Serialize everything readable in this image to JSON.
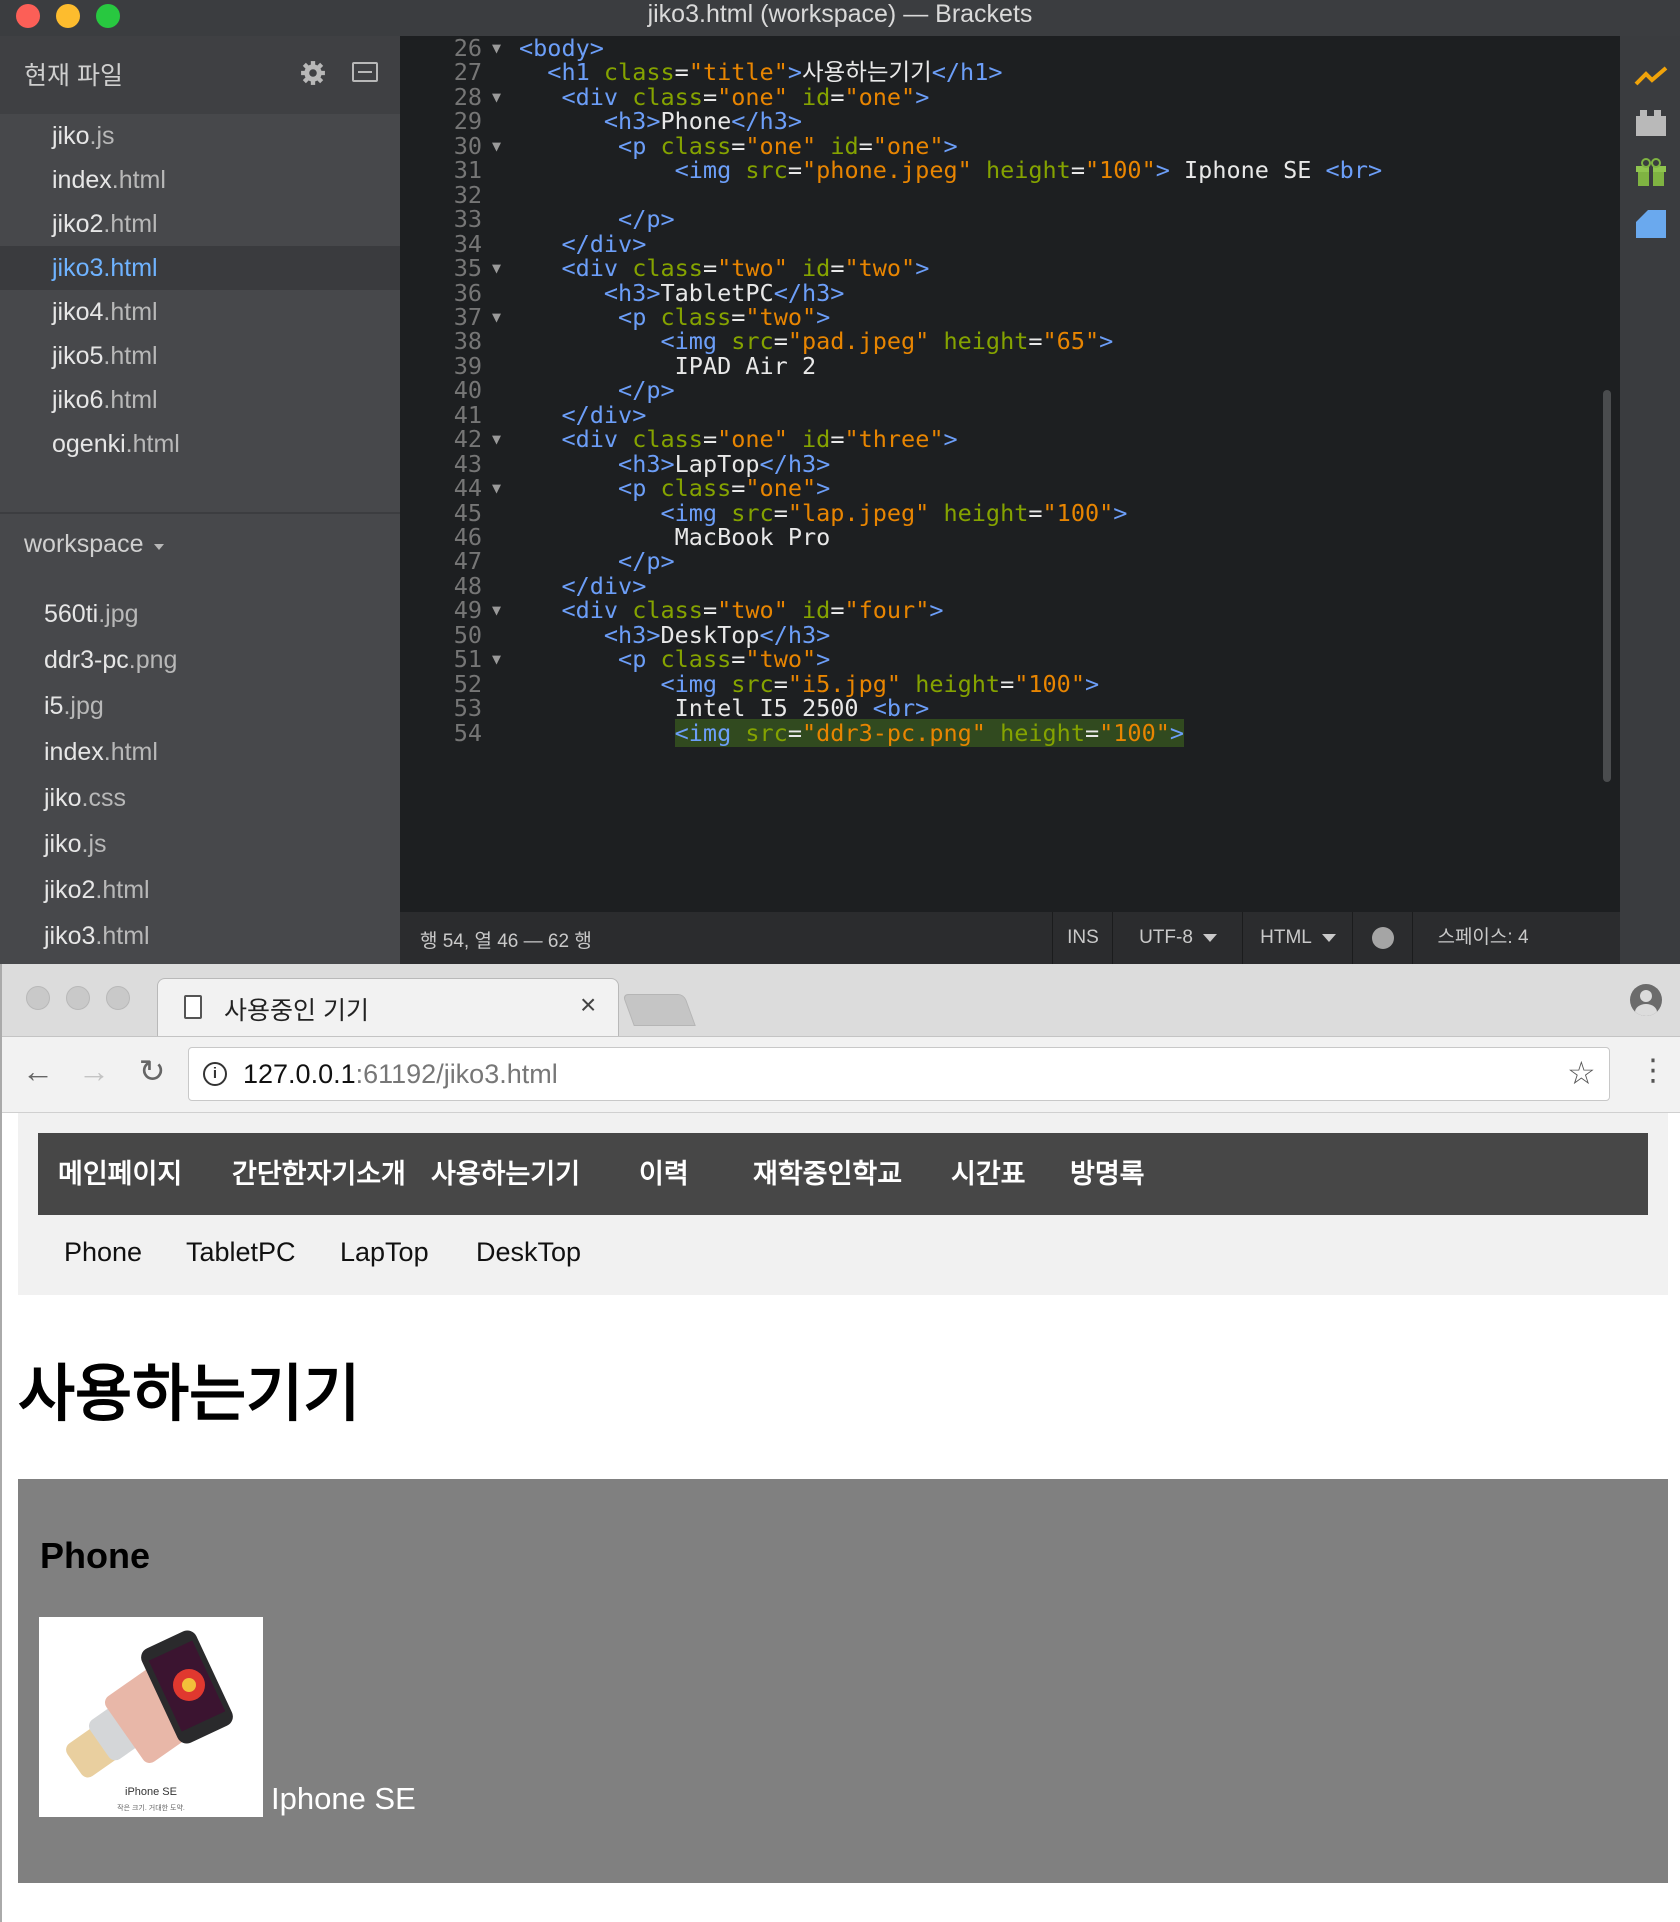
{
  "brackets": {
    "window_title": "jiko3.html (workspace) — Brackets",
    "working_files_title": "현재 파일",
    "working_files": [
      {
        "name": "jiko",
        "ext": ".js",
        "selected": false
      },
      {
        "name": "index",
        "ext": ".html",
        "selected": false
      },
      {
        "name": "jiko2",
        "ext": ".html",
        "selected": false
      },
      {
        "name": "jiko3",
        "ext": ".html",
        "selected": true
      },
      {
        "name": "jiko4",
        "ext": ".html",
        "selected": false
      },
      {
        "name": "jiko5",
        "ext": ".html",
        "selected": false
      },
      {
        "name": "jiko6",
        "ext": ".html",
        "selected": false
      },
      {
        "name": "ogenki",
        "ext": ".html",
        "selected": false
      }
    ],
    "project_title": "workspace",
    "project_files": [
      {
        "name": "560ti",
        "ext": ".jpg"
      },
      {
        "name": "ddr3-pc",
        "ext": ".png"
      },
      {
        "name": "i5",
        "ext": ".jpg"
      },
      {
        "name": "index",
        "ext": ".html"
      },
      {
        "name": "jiko",
        "ext": ".css"
      },
      {
        "name": "jiko",
        "ext": ".js"
      },
      {
        "name": "jiko2",
        "ext": ".html"
      },
      {
        "name": "jiko3",
        "ext": ".html"
      }
    ],
    "code_lines": [
      {
        "n": "26",
        "fold": true,
        "indent": "",
        "text": "<body>"
      },
      {
        "n": "27",
        "fold": false,
        "indent": "  ",
        "text": "<h1 class=\"title\">사용하는기기</h1>"
      },
      {
        "n": "28",
        "fold": true,
        "indent": "   ",
        "text": "<div class=\"one\" id=\"one\">"
      },
      {
        "n": "29",
        "fold": false,
        "indent": "      ",
        "text": "<h3>Phone</h3>"
      },
      {
        "n": "30",
        "fold": true,
        "indent": "       ",
        "text": "<p class=\"one\" id=\"one\">"
      },
      {
        "n": "31",
        "fold": false,
        "indent": "           ",
        "text": "<img src=\"phone.jpeg\" height=\"100\"> Iphone SE <br>"
      },
      {
        "n": "32",
        "fold": false,
        "indent": "",
        "text": ""
      },
      {
        "n": "33",
        "fold": false,
        "indent": "       ",
        "text": "</p>"
      },
      {
        "n": "34",
        "fold": false,
        "indent": "   ",
        "text": "</div>"
      },
      {
        "n": "35",
        "fold": true,
        "indent": "   ",
        "text": "<div class=\"two\" id=\"two\">"
      },
      {
        "n": "36",
        "fold": false,
        "indent": "      ",
        "text": "<h3>TabletPC</h3>"
      },
      {
        "n": "37",
        "fold": true,
        "indent": "       ",
        "text": "<p class=\"two\">"
      },
      {
        "n": "38",
        "fold": false,
        "indent": "          ",
        "text": "<img src=\"pad.jpeg\" height=\"65\">"
      },
      {
        "n": "39",
        "fold": false,
        "indent": "           ",
        "text": "IPAD Air 2"
      },
      {
        "n": "40",
        "fold": false,
        "indent": "       ",
        "text": "</p>"
      },
      {
        "n": "41",
        "fold": false,
        "indent": "   ",
        "text": "</div>"
      },
      {
        "n": "42",
        "fold": true,
        "indent": "   ",
        "text": "<div class=\"one\" id=\"three\">"
      },
      {
        "n": "43",
        "fold": false,
        "indent": "       ",
        "text": "<h3>LapTop</h3>"
      },
      {
        "n": "44",
        "fold": true,
        "indent": "       ",
        "text": "<p class=\"one\">"
      },
      {
        "n": "45",
        "fold": false,
        "indent": "          ",
        "text": "<img src=\"lap.jpeg\" height=\"100\">"
      },
      {
        "n": "46",
        "fold": false,
        "indent": "           ",
        "text": "MacBook Pro"
      },
      {
        "n": "47",
        "fold": false,
        "indent": "       ",
        "text": "</p>"
      },
      {
        "n": "48",
        "fold": false,
        "indent": "   ",
        "text": "</div>"
      },
      {
        "n": "49",
        "fold": true,
        "indent": "   ",
        "text": "<div class=\"two\" id=\"four\">"
      },
      {
        "n": "50",
        "fold": false,
        "indent": "      ",
        "text": "<h3>DeskTop</h3>"
      },
      {
        "n": "51",
        "fold": true,
        "indent": "       ",
        "text": "<p class=\"two\">"
      },
      {
        "n": "52",
        "fold": false,
        "indent": "          ",
        "text": "<img src=\"i5.jpg\" height=\"100\">"
      },
      {
        "n": "53",
        "fold": false,
        "indent": "           ",
        "text": "Intel I5 2500 <br>"
      },
      {
        "n": "54",
        "fold": false,
        "indent": "           ",
        "text": "<img src=\"ddr3-pc.png\" height=\"100\">",
        "highlight": true
      }
    ],
    "status": {
      "cursor": "행 54, 열 46 — 62 행",
      "mode": "INS",
      "encoding": "UTF-8",
      "language": "HTML",
      "indent": "스페이스: 4"
    },
    "colors": {
      "tag": "#6c9ef8",
      "attr": "#85a300",
      "value": "#e88501",
      "selected_file": "#6fb3ff"
    },
    "toolbar_icons": [
      "live-preview-icon",
      "extension-manager-icon",
      "extension-gift-icon",
      "blue-square-icon"
    ]
  },
  "chrome": {
    "tab_title": "사용중인 기기",
    "url_host": "127.0.0.1",
    "url_path": ":61192/jiko3.html",
    "page": {
      "main_nav": [
        "메인페이지",
        "간단한자기소개",
        "사용하는기기",
        "이력",
        "재학중인학교",
        "시간표",
        "방명록"
      ],
      "sub_nav": [
        "Phone",
        "TabletPC",
        "LapTop",
        "DeskTop"
      ],
      "heading": "사용하는기기",
      "section_title": "Phone",
      "phone_caption": "Iphone SE",
      "phone_image_text": "iPhone SE",
      "phone_image_subtext": "작은 크기. 거대한 도약."
    }
  }
}
